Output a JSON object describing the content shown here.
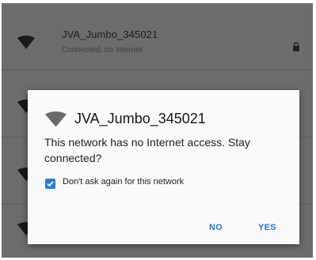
{
  "networks": [
    {
      "ssid": "JVA_Jumbo_345021",
      "status": "Connected, no Internet"
    },
    {
      "ssid": "",
      "status": ""
    },
    {
      "ssid": "",
      "status": ""
    },
    {
      "ssid": "",
      "status": ""
    }
  ],
  "dialog": {
    "title": "JVA_Jumbo_345021",
    "message": "This network has no Internet access. Stay connected?",
    "checkbox_label": "Don't ask again for this network",
    "checkbox_checked": true,
    "no_label": "NO",
    "yes_label": "YES"
  },
  "colors": {
    "accent": "#2e7bd3",
    "button_text": "#2c73c9",
    "list_background": "#6c6c6c",
    "dialog_background": "#fafafa"
  },
  "icons": {
    "network": "wifi-icon",
    "secured": "lock-icon",
    "checkbox": "check-icon"
  }
}
